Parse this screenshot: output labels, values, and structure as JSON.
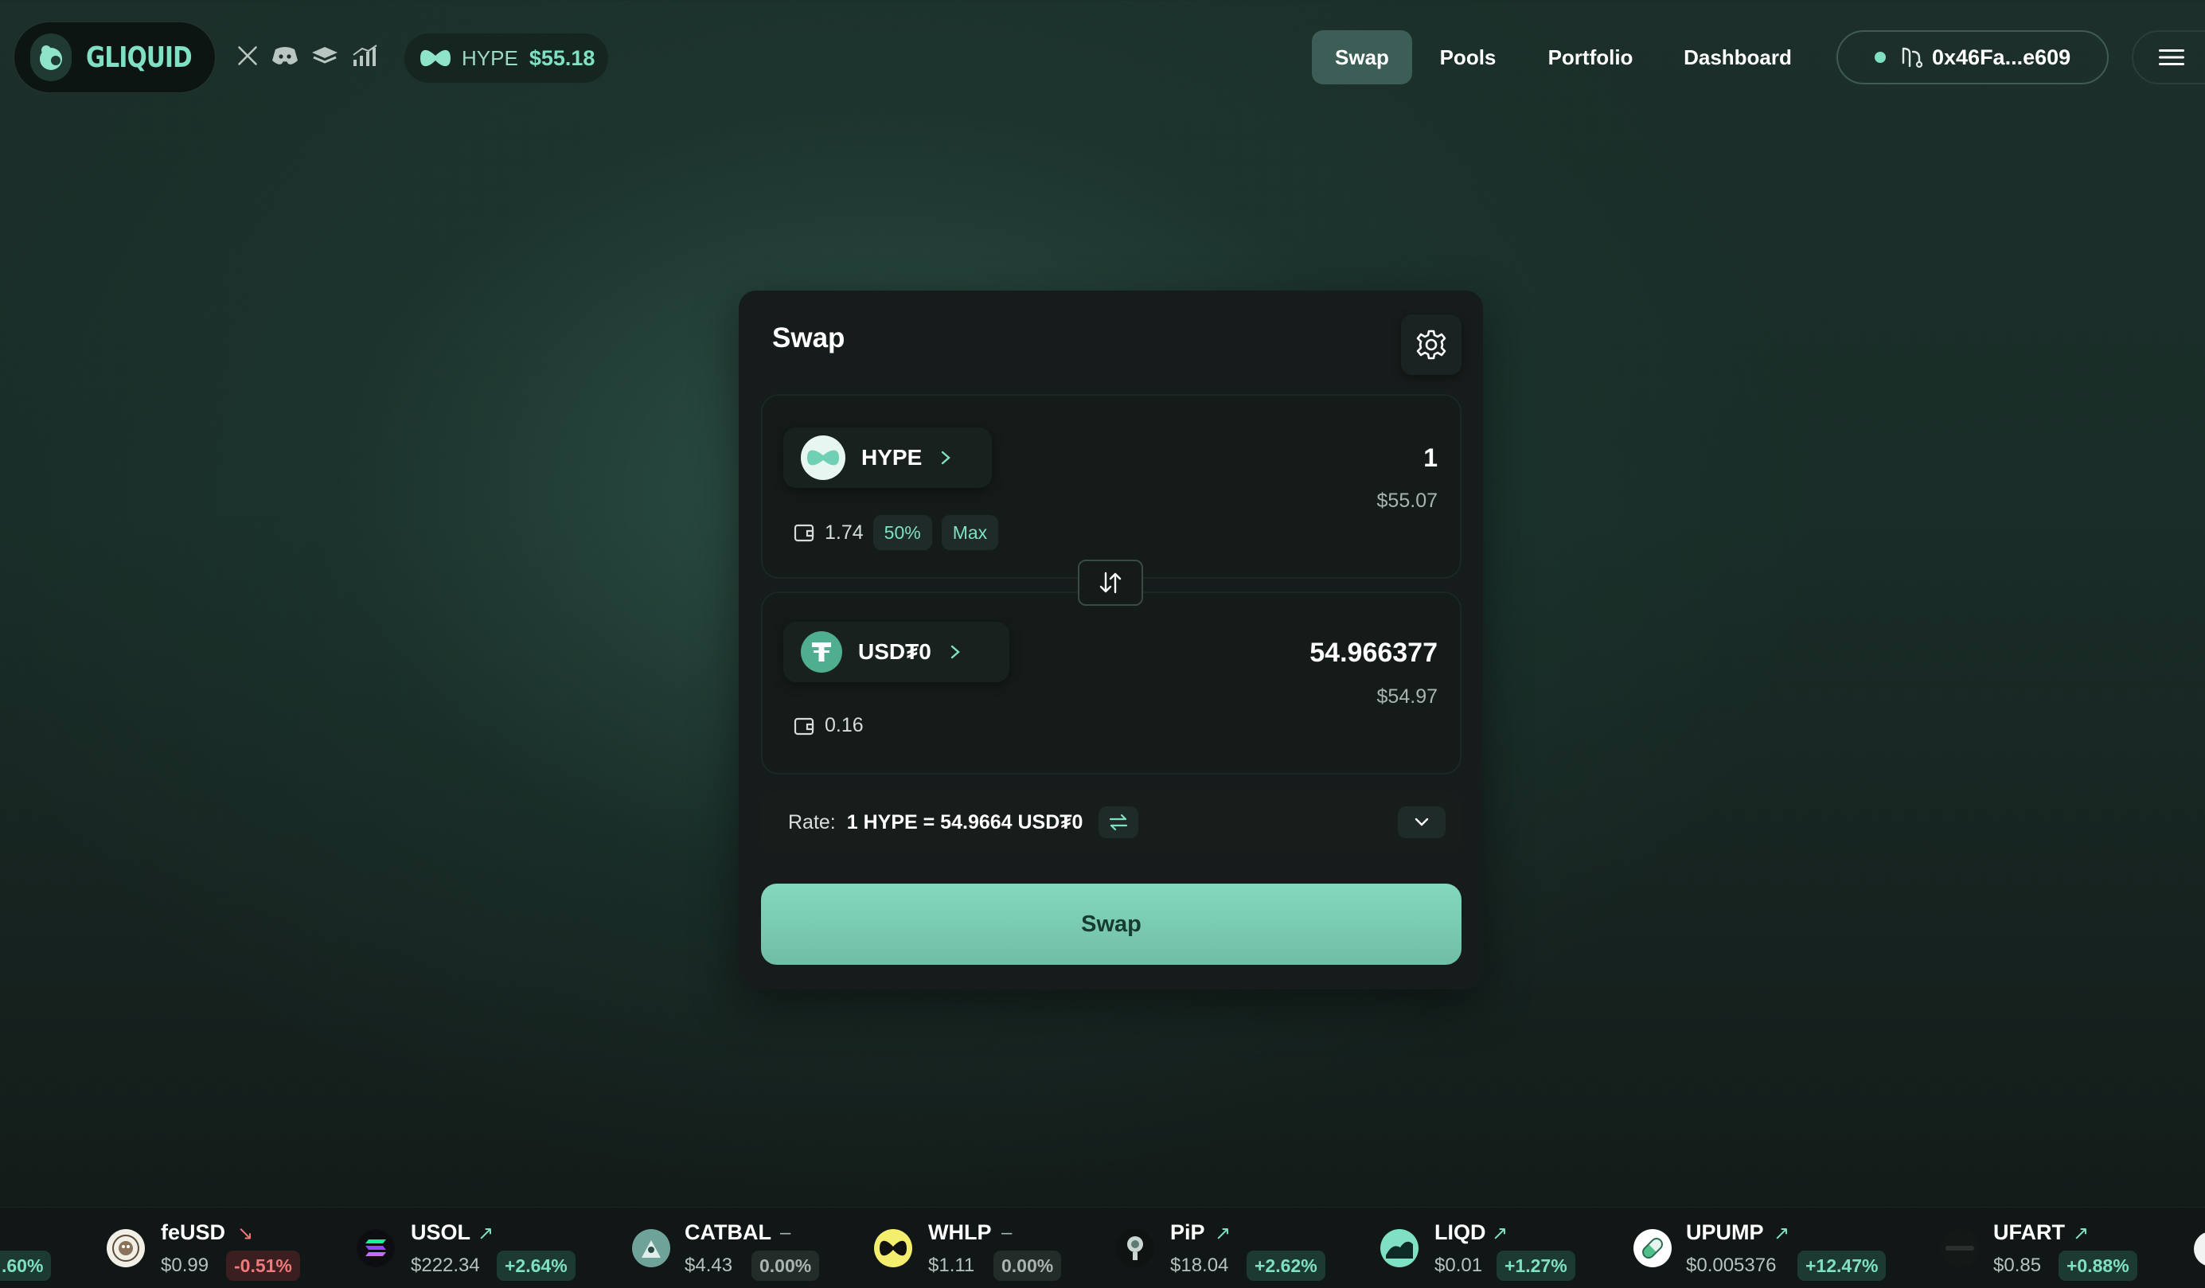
{
  "header": {
    "logo_text": "GLIQUID",
    "social_icons": [
      "x-icon",
      "discord-icon",
      "docs-icon",
      "analytics-icon"
    ],
    "hype_ticker": {
      "symbol": "HYPE",
      "price": "$55.18"
    },
    "nav": [
      {
        "label": "Swap",
        "active": true
      },
      {
        "label": "Pools",
        "active": false
      },
      {
        "label": "Portfolio",
        "active": false
      },
      {
        "label": "Dashboard",
        "active": false
      }
    ],
    "wallet": {
      "address": "0x46Fa...e609",
      "connected": true
    },
    "menu_icon": "hamburger-menu-icon"
  },
  "swap": {
    "title": "Swap",
    "settings_icon": "gear-icon",
    "from": {
      "token": "HYPE",
      "amount": "1",
      "usd_value": "$55.07",
      "balance": "1.74",
      "half_label": "50%",
      "max_label": "Max"
    },
    "to": {
      "token": "USD₮0",
      "amount": "54.966377",
      "usd_value": "$54.97",
      "balance": "0.16"
    },
    "rate": {
      "label": "Rate:",
      "value": "1 HYPE = 54.9664 USD₮0"
    },
    "cta_label": "Swap"
  },
  "ticker": {
    "leading_fragment": ".60%",
    "items": [
      {
        "symbol": "feUSD",
        "price": "$0.99",
        "change": "-0.51%",
        "direction": "down"
      },
      {
        "symbol": "USOL",
        "price": "$222.34",
        "change": "+2.64%",
        "direction": "up"
      },
      {
        "symbol": "CATBAL",
        "price": "$4.43",
        "change": "0.00%",
        "direction": "flat"
      },
      {
        "symbol": "WHLP",
        "price": "$1.11",
        "change": "0.00%",
        "direction": "flat"
      },
      {
        "symbol": "PiP",
        "price": "$18.04",
        "change": "+2.62%",
        "direction": "up"
      },
      {
        "symbol": "LIQD",
        "price": "$0.01",
        "change": "+1.27%",
        "direction": "up"
      },
      {
        "symbol": "UPUMP",
        "price": "$0.005376",
        "change": "+12.47%",
        "direction": "up"
      },
      {
        "symbol": "UFART",
        "price": "$0.85",
        "change": "+0.88%",
        "direction": "up"
      }
    ]
  },
  "colors": {
    "accent": "#7fe0c3",
    "positive": "#7fe0c3",
    "negative": "#f07a7a",
    "card": "#161c1b",
    "cta": "#78cbb1"
  }
}
